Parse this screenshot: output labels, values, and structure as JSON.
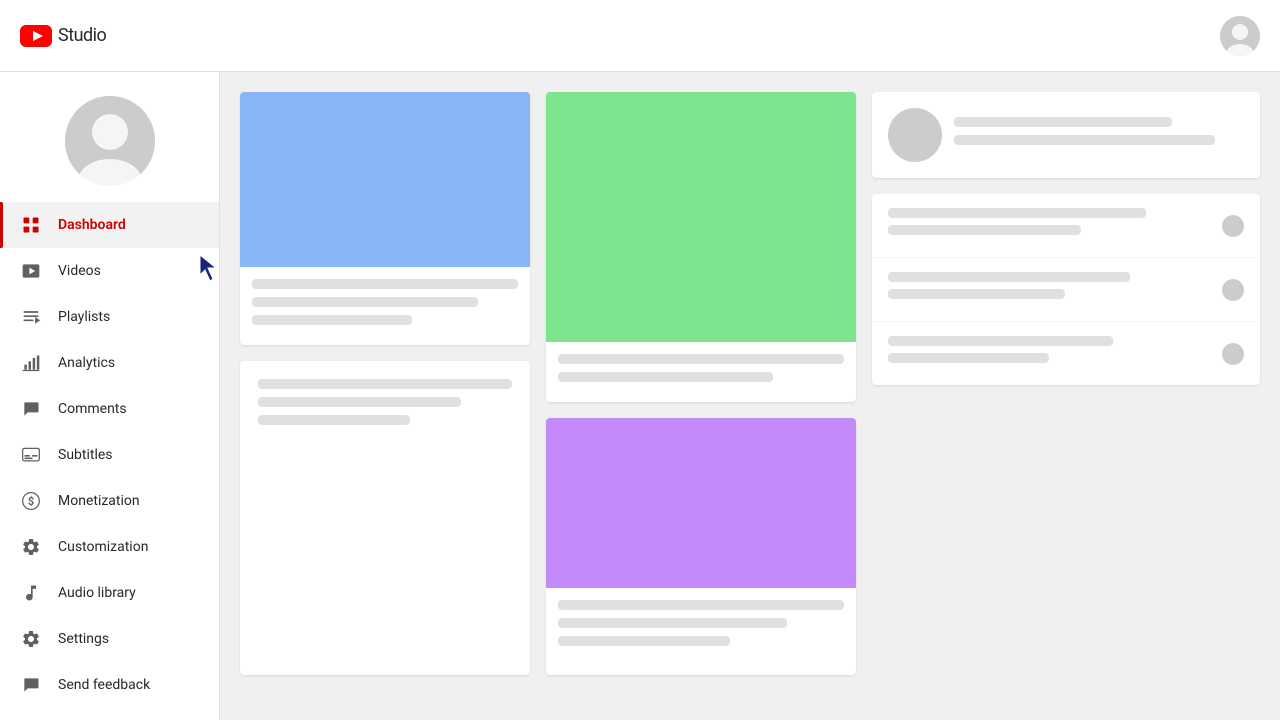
{
  "header": {
    "logo_text": "Studio",
    "title": "YouTube Studio"
  },
  "sidebar": {
    "nav_items": [
      {
        "id": "dashboard",
        "label": "Dashboard",
        "active": true
      },
      {
        "id": "videos",
        "label": "Videos",
        "active": false
      },
      {
        "id": "playlists",
        "label": "Playlists",
        "active": false
      },
      {
        "id": "analytics",
        "label": "Analytics",
        "active": false
      },
      {
        "id": "comments",
        "label": "Comments",
        "active": false
      },
      {
        "id": "subtitles",
        "label": "Subtitles",
        "active": false
      },
      {
        "id": "monetization",
        "label": "Monetization",
        "active": false
      },
      {
        "id": "customization",
        "label": "Customization",
        "active": false
      },
      {
        "id": "audio-library",
        "label": "Audio library",
        "active": false
      }
    ],
    "bottom_items": [
      {
        "id": "settings",
        "label": "Settings"
      },
      {
        "id": "send-feedback",
        "label": "Send feedback"
      }
    ]
  },
  "colors": {
    "active_nav": "#cc0000",
    "card1_thumb": "#8ab4f8",
    "card2_thumb": "#7de58e",
    "card6_thumb": "#c58af9",
    "skeleton": "#e0e0e0"
  }
}
